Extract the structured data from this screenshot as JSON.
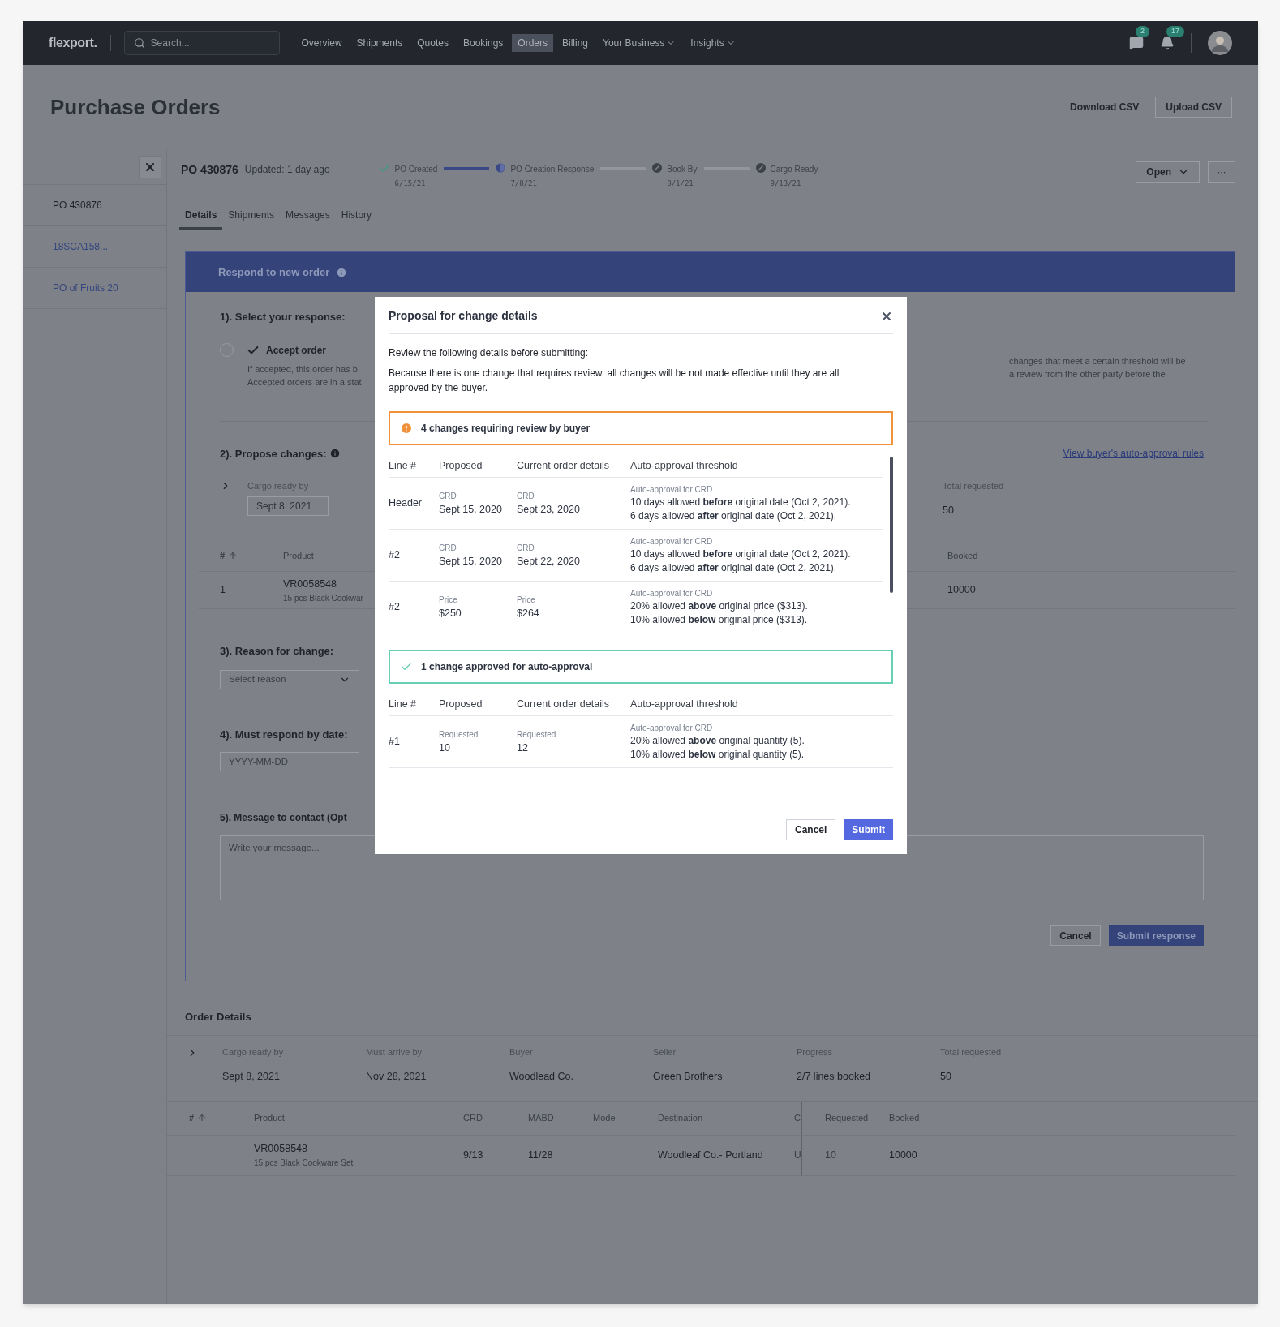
{
  "nav": {
    "logo": "flexport.",
    "search": {
      "placeholder": "Search..."
    },
    "items": [
      {
        "label": "Overview",
        "selected": false,
        "dropdown": false
      },
      {
        "label": "Shipments",
        "selected": false,
        "dropdown": false
      },
      {
        "label": "Quotes",
        "selected": false,
        "dropdown": false
      },
      {
        "label": "Bookings",
        "selected": false,
        "dropdown": false
      },
      {
        "label": "Orders",
        "selected": true,
        "dropdown": false
      },
      {
        "label": "Billing",
        "selected": false,
        "dropdown": false
      },
      {
        "label": "Your Business",
        "selected": false,
        "dropdown": true
      },
      {
        "label": "Insights",
        "selected": false,
        "dropdown": true
      }
    ],
    "messages_badge": "2",
    "notifications_badge": "17"
  },
  "page": {
    "title": "Purchase Orders",
    "actions": [
      {
        "label": "Download CSV",
        "kind": "link"
      },
      {
        "label": "Upload CSV",
        "kind": "button"
      }
    ]
  },
  "sidebar": {
    "items": [
      {
        "label": "PO 430876",
        "selected": true
      },
      {
        "label": "18SCA158...",
        "selected": false
      },
      {
        "label": "PO of Fruits 20",
        "selected": false
      }
    ]
  },
  "po": {
    "id": "PO 430876",
    "updated": "Updated: 1 day ago",
    "steps": [
      {
        "label": "PO Created",
        "date": "6/15/21",
        "kind": "done"
      },
      {
        "label": "PO Creation Response",
        "date": "7/8/21",
        "kind": "current"
      },
      {
        "label": "Book By",
        "date": "8/1/21",
        "kind": "pending"
      },
      {
        "label": "Cargo Ready",
        "date": "9/13/21",
        "kind": "pending"
      }
    ],
    "status_button": "Open",
    "more_button": "···"
  },
  "tabs": [
    {
      "label": "Details",
      "selected": true
    },
    {
      "label": "Shipments",
      "selected": false
    },
    {
      "label": "Messages",
      "selected": false
    },
    {
      "label": "History",
      "selected": false
    }
  ],
  "respond": {
    "title": "Respond to new order",
    "step1": {
      "title": "1). Select your response:",
      "option": {
        "label": "Accept order",
        "selected": false
      },
      "desc_left": [
        "If accepted, this order has b",
        "Accepted orders are in a stat"
      ],
      "desc_right": [
        "changes that meet a certain threshold will be",
        "a review from the other party before the"
      ]
    },
    "step2": {
      "title": "2). Propose changes:",
      "link": "View buyer's auto-approval rules",
      "fields": [
        {
          "label": "Cargo ready by",
          "value": "Sept 8, 2021",
          "kind": "input"
        },
        {
          "label": "Total requested",
          "value": "50",
          "kind": "text"
        }
      ],
      "columns": [
        "#",
        "Product",
        "Booked"
      ],
      "row": {
        "line": "1",
        "product": "VR0058548",
        "description": "15 pcs Black Cookwar",
        "booked": "10000"
      }
    },
    "step3": {
      "title": "3). Reason for change:",
      "placeholder": "Select reason"
    },
    "step4": {
      "title": "4). Must respond by date:",
      "placeholder": "YYYY-MM-DD"
    },
    "step5": {
      "title": "5). Message to contact (Opt",
      "placeholder": "Write your message..."
    },
    "buttons": [
      "Cancel",
      "Submit response"
    ]
  },
  "order_details": {
    "title": "Order Details",
    "fields": [
      {
        "label": "Cargo ready by",
        "value": "Sept 8, 2021"
      },
      {
        "label": "Must arrive by",
        "value": "Nov 28, 2021"
      },
      {
        "label": "Buyer",
        "value": "Woodlead Co."
      },
      {
        "label": "Seller",
        "value": "Green Brothers"
      },
      {
        "label": "Progress",
        "value": "2/7 lines booked"
      },
      {
        "label": "Total requested",
        "value": "50"
      }
    ],
    "columns": [
      "#",
      "Product",
      "CRD",
      "MABD",
      "Mode",
      "Destination",
      "C",
      "Requested",
      "Booked"
    ],
    "row": {
      "product": "VR0058548",
      "description": "15 pcs Black Cookware Set",
      "crd": "9/13",
      "mabd": "11/28",
      "destination": "Woodleaf Co.- Portland",
      "column_7": "U",
      "requested": "10",
      "booked": "10000"
    }
  },
  "modal": {
    "title": "Proposal for change details",
    "intro": "Review the following details before submitting:",
    "body": "Because there is one change that requires review, all changes will be not made effective until they are all approved by the buyer.",
    "groups": [
      {
        "kind": "warning",
        "title": "4 changes requiring review by buyer",
        "columns": [
          "Line #",
          "Proposed",
          "Current order details",
          "Auto-approval threshold"
        ],
        "rows": [
          {
            "line": "Header",
            "proposed": {
              "label": "CRD",
              "value": "Sept 15, 2020"
            },
            "current": {
              "label": "CRD",
              "value": "Sept 23, 2020"
            },
            "threshold": {
              "label": "Auto-approval for CRD",
              "lines": [
                "10 days allowed **before** original date (Oct 2, 2021).",
                "6 days allowed **after** original date (Oct 2, 2021)."
              ]
            }
          },
          {
            "line": "#2",
            "proposed": {
              "label": "CRD",
              "value": "Sept 15, 2020"
            },
            "current": {
              "label": "CRD",
              "value": "Sept 22, 2020"
            },
            "threshold": {
              "label": "Auto-approval for CRD",
              "lines": [
                "10 days allowed **before** original date (Oct 2, 2021).",
                "6 days allowed **after** original date (Oct 2, 2021)."
              ]
            }
          },
          {
            "line": "#2",
            "proposed": {
              "label": "Price",
              "value": "$250"
            },
            "current": {
              "label": "Price",
              "value": "$264"
            },
            "threshold": {
              "label": "Auto-approval for CRD",
              "lines": [
                "20% allowed **above** original price ($313).",
                "10% allowed **below** original price ($313)."
              ]
            }
          }
        ]
      },
      {
        "kind": "approved",
        "title": "1 change approved for auto-approval",
        "columns": [
          "Line #",
          "Proposed",
          "Current order details",
          "Auto-approval threshold"
        ],
        "rows": [
          {
            "line": "#1",
            "proposed": {
              "label": "Requested",
              "value": "10"
            },
            "current": {
              "label": "Requested",
              "value": "12"
            },
            "threshold": {
              "label": "Auto-approval for CRD",
              "lines": [
                "20% allowed **above** original quantity (5).",
                "10% allowed **below** original quantity (5)."
              ]
            }
          }
        ]
      }
    ],
    "buttons": [
      {
        "label": "Cancel",
        "kind": "secondary"
      },
      {
        "label": "Submit",
        "kind": "primary"
      }
    ]
  }
}
